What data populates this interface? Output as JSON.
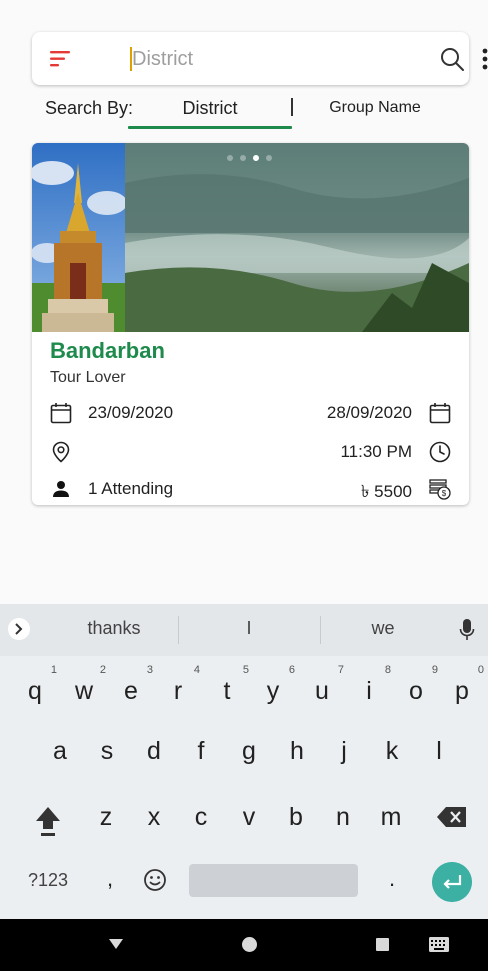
{
  "search": {
    "placeholder": "District"
  },
  "tabs": {
    "search_by_label": "Search By:",
    "district_label": "District",
    "group_name_label": "Group Name",
    "accent_color": "#1e8a4c"
  },
  "card": {
    "title": "Bandarban",
    "subtitle": "Tour Lover",
    "start_date": "23/09/2020",
    "end_date": "28/09/2020",
    "time": "11:30 PM",
    "attending": "1 Attending",
    "price": "৳ 5500",
    "slider_dots": 3,
    "active_dot": 1
  },
  "keyboard": {
    "suggestions": [
      "thanks",
      "I",
      "we"
    ],
    "row1": [
      "q",
      "w",
      "e",
      "r",
      "t",
      "y",
      "u",
      "i",
      "o",
      "p"
    ],
    "row1_hints": [
      "1",
      "2",
      "3",
      "4",
      "5",
      "6",
      "7",
      "8",
      "9",
      "0"
    ],
    "row2": [
      "a",
      "s",
      "d",
      "f",
      "g",
      "h",
      "j",
      "k",
      "l"
    ],
    "row3": [
      "z",
      "x",
      "c",
      "v",
      "b",
      "n",
      "m"
    ],
    "symbols_label": "?123",
    "comma": ",",
    "period": "."
  },
  "icons": {
    "menu": "filter-lines-icon",
    "search": "search-icon",
    "more": "more-vertical-icon",
    "calendar": "calendar-icon",
    "location": "location-pin-icon",
    "clock": "clock-icon",
    "person": "person-icon",
    "money": "money-icon",
    "mic": "mic-icon",
    "shift": "shift-icon",
    "backspace": "backspace-icon",
    "emoji": "emoji-icon",
    "enter": "enter-icon"
  }
}
